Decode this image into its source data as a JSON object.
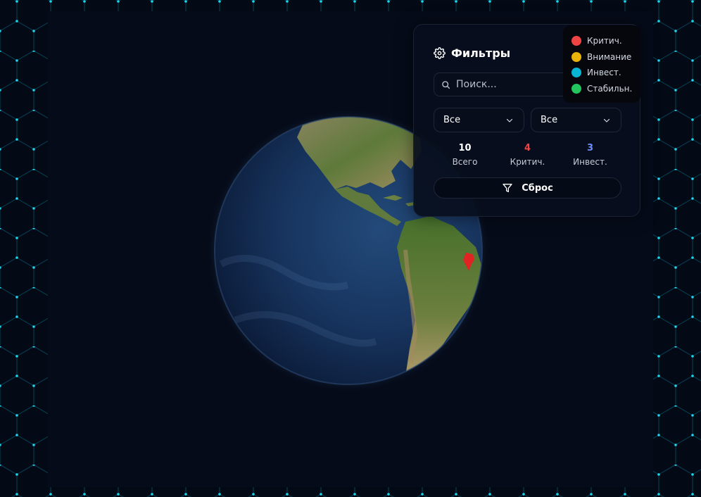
{
  "filters": {
    "title": "Фильтры",
    "title_icon": "gear-icon",
    "search": {
      "placeholder": "Поиск...",
      "value": ""
    },
    "selects": [
      {
        "selected": "Все"
      },
      {
        "selected": "Все"
      }
    ],
    "stats": [
      {
        "value": "10",
        "label": "Всего",
        "color": "#ffffff"
      },
      {
        "value": "4",
        "label": "Критич.",
        "color": "#ef4444"
      },
      {
        "value": "3",
        "label": "Инвест.",
        "color": "#6b8cff"
      }
    ],
    "reset_label": "Сброс",
    "reset_icon": "filter-icon"
  },
  "legend": [
    {
      "label": "Критич.",
      "color": "#ef4444"
    },
    {
      "label": "Внимание",
      "color": "#eab308"
    },
    {
      "label": "Инвест.",
      "color": "#06b6d4"
    },
    {
      "label": "Стабильн.",
      "color": "#22c55e"
    }
  ],
  "globe": {
    "marker_color": "#e02424"
  },
  "colors": {
    "background": "#030a15",
    "hex_grid": "#0ea5c6",
    "panel": "#080e1c"
  }
}
